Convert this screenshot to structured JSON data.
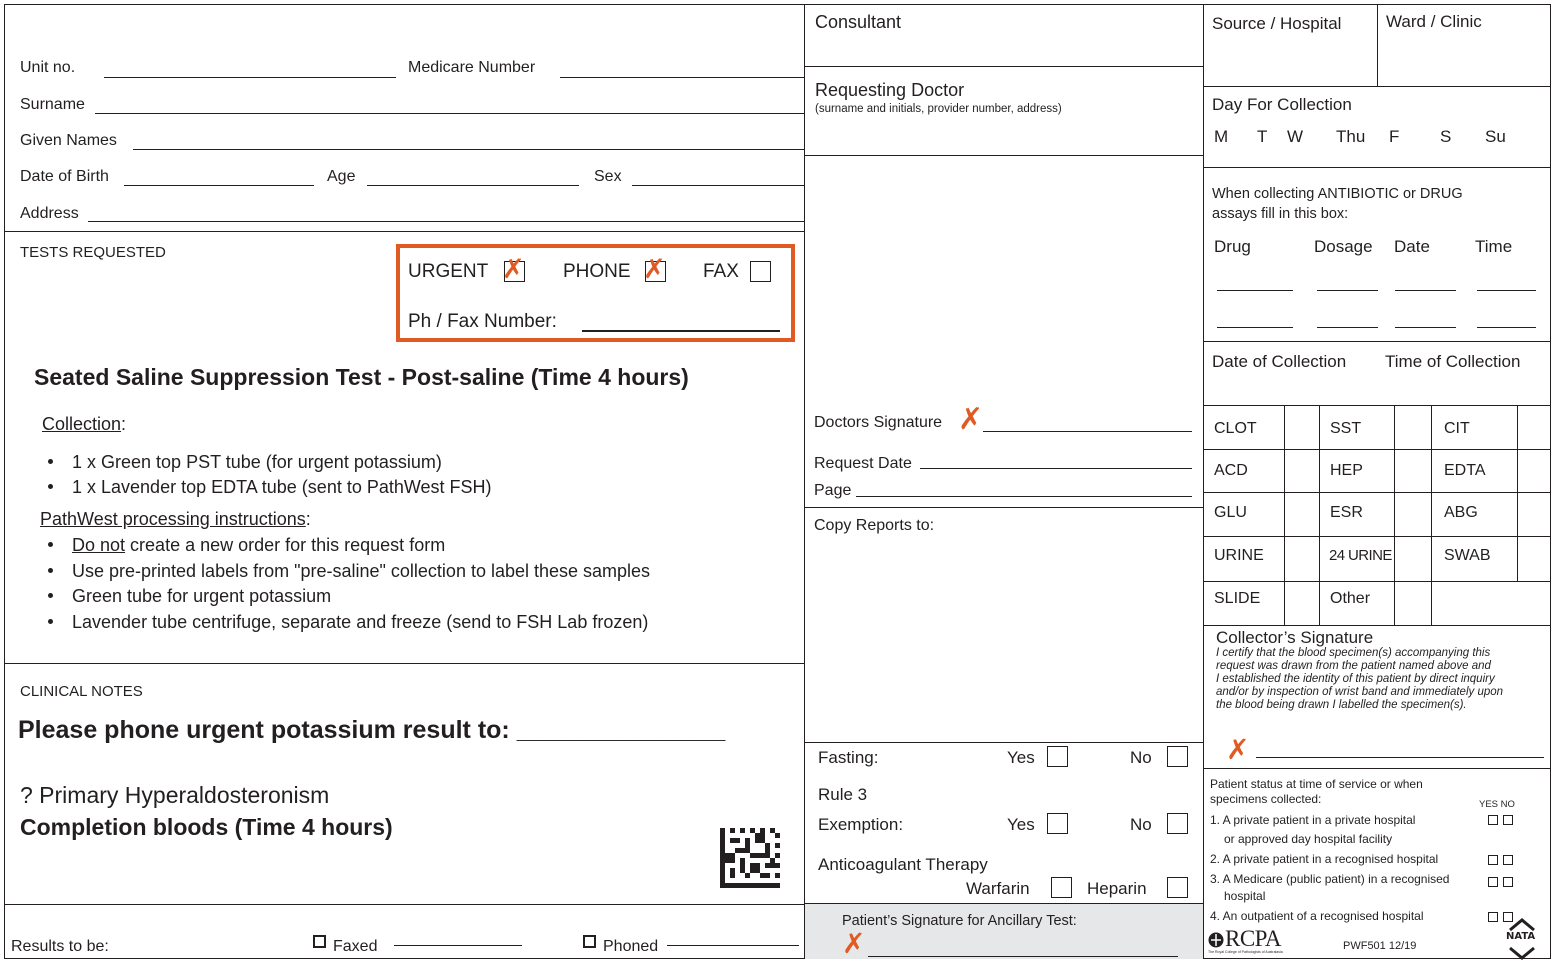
{
  "patient": {
    "unit_no": "Unit no.",
    "medicare": "Medicare Number",
    "surname": "Surname",
    "given": "Given Names",
    "dob": "Date of Birth",
    "age": "Age",
    "sex": "Sex",
    "address": "Address"
  },
  "tests": {
    "heading": "TESTS REQUESTED",
    "urgent": "URGENT",
    "phone": "PHONE",
    "fax": "FAX",
    "ph_fax": "Ph / Fax Number:",
    "title": "Seated Saline Suppression Test - Post-saline (Time 4 hours)",
    "collection": "Collection",
    "collection_items": [
      "1 x Green top PST tube (for urgent potassium)",
      "1 x Lavender top EDTA tube (sent to PathWest FSH)"
    ],
    "processing": "PathWest processing instructions",
    "donot": "Do not",
    "proc_item1_rest": " create a new order for this request form",
    "processing_items": [
      "Use pre-printed labels from \"pre-saline\" collection to label these samples",
      "Green tube for urgent potassium",
      "Lavender tube centrifuge, separate and freeze (send to FSH Lab frozen)"
    ],
    "colon": ":"
  },
  "clinical": {
    "heading": "CLINICAL NOTES",
    "phone_result": "Please phone urgent potassium result to: _______________",
    "diagnosis": "? Primary Hyperaldosteronism",
    "completion": "Completion bloods (Time 4 hours)"
  },
  "results": {
    "label": "Results to be:",
    "faxed": "Faxed",
    "phoned": "Phoned"
  },
  "doctor": {
    "consultant": "Consultant",
    "requesting": "Requesting Doctor",
    "requesting_sub": "(surname and initials, provider number, address)",
    "signature": "Doctors Signature",
    "request_date": "Request Date",
    "page": "Page",
    "copy_reports": "Copy Reports to:"
  },
  "fasting": {
    "fasting": "Fasting:",
    "yes": "Yes",
    "no": "No",
    "rule3": "Rule 3",
    "exemption": "Exemption:",
    "anticoag": "Anticoagulant Therapy",
    "warfarin": "Warfarin",
    "heparin": "Heparin",
    "patient_sig": "Patient’s Signature for Ancillary Test:"
  },
  "right": {
    "source": "Source / Hospital",
    "ward": "Ward / Clinic",
    "day_for": "Day For Collection",
    "days": [
      "M",
      "T",
      "W",
      "Thu",
      "F",
      "S",
      "Su"
    ],
    "antibiotic": "When collecting ANTIBIOTIC or DRUG",
    "antibiotic2": "assays fill in this box:",
    "drug": "Drug",
    "dosage": "Dosage",
    "date": "Date",
    "time": "Time",
    "date_coll": "Date of Collection",
    "time_coll": "Time of Collection",
    "tubes": [
      [
        "CLOT",
        "SST",
        "CIT"
      ],
      [
        "ACD",
        "HEP",
        "EDTA"
      ],
      [
        "GLU",
        "ESR",
        "ABG"
      ],
      [
        "URINE",
        "24 URINE",
        "SWAB"
      ],
      [
        "SLIDE",
        "Other",
        ""
      ]
    ],
    "collector": "Collector’s Signature",
    "certify": [
      "I certify that the blood specimen(s) accompanying this",
      "request was drawn from the patient named above and",
      "I established the identity of this patient by direct inquiry",
      "and/or by inspection of wrist band and immediately upon",
      "the blood being drawn I labelled the specimen(s)."
    ],
    "status1": "Patient status at time of service or when",
    "status2": "specimens collected:",
    "yesno": "YES NO",
    "status_items": [
      "1. A private patient in a private hospital",
      "or approved day hospital facility",
      "2. A private patient in a recognised hospital",
      "3. A Medicare (public patient) in a recognised",
      "hospital",
      "4. An outpatient of a recognised hospital"
    ],
    "rcpa": "RCPA",
    "rcpa_sub": "The Royal College of Pathologists of Australasia",
    "form_code": "PWF501 12/19",
    "nata": "NATA"
  },
  "marks": {
    "x": "✗"
  },
  "colors": {
    "accent": "#e05a24",
    "ink": "#231f20",
    "shade": "#e6e7e8"
  }
}
